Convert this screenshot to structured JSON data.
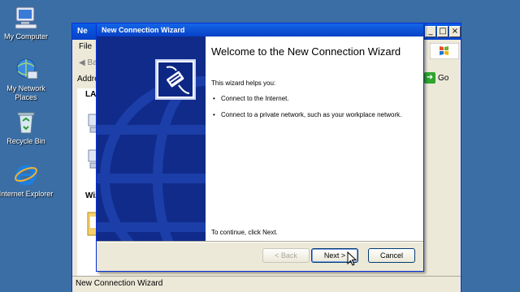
{
  "desktop": {
    "icons": [
      {
        "label": "My Computer"
      },
      {
        "label": "My Network Places"
      },
      {
        "label": "Recycle Bin"
      },
      {
        "label": "Internet Explorer"
      }
    ]
  },
  "background_window": {
    "title_fragment": "Ne",
    "menu_fragment": "File",
    "back_fragment": "Ba",
    "address_fragment": "Addre",
    "section_lan": "LAN",
    "section_wizard": "Wiz",
    "go_label": "Go",
    "status_text": "New Connection Wizard",
    "controls": [
      "_",
      "□",
      "×"
    ]
  },
  "wizard": {
    "title": "New Connection Wizard",
    "heading": "Welcome to the New Connection Wizard",
    "intro": "This wizard helps you:",
    "bullets": [
      "Connect to the Internet.",
      "Connect to a private network, such as your workplace network."
    ],
    "continue_text": "To continue, click Next.",
    "buttons": {
      "back": "< Back",
      "next": "Next >",
      "cancel": "Cancel"
    }
  },
  "colors": {
    "desktop": "#3a6ea5",
    "titlebar": "#0a5de7",
    "wizard_side": "#102b8a"
  }
}
